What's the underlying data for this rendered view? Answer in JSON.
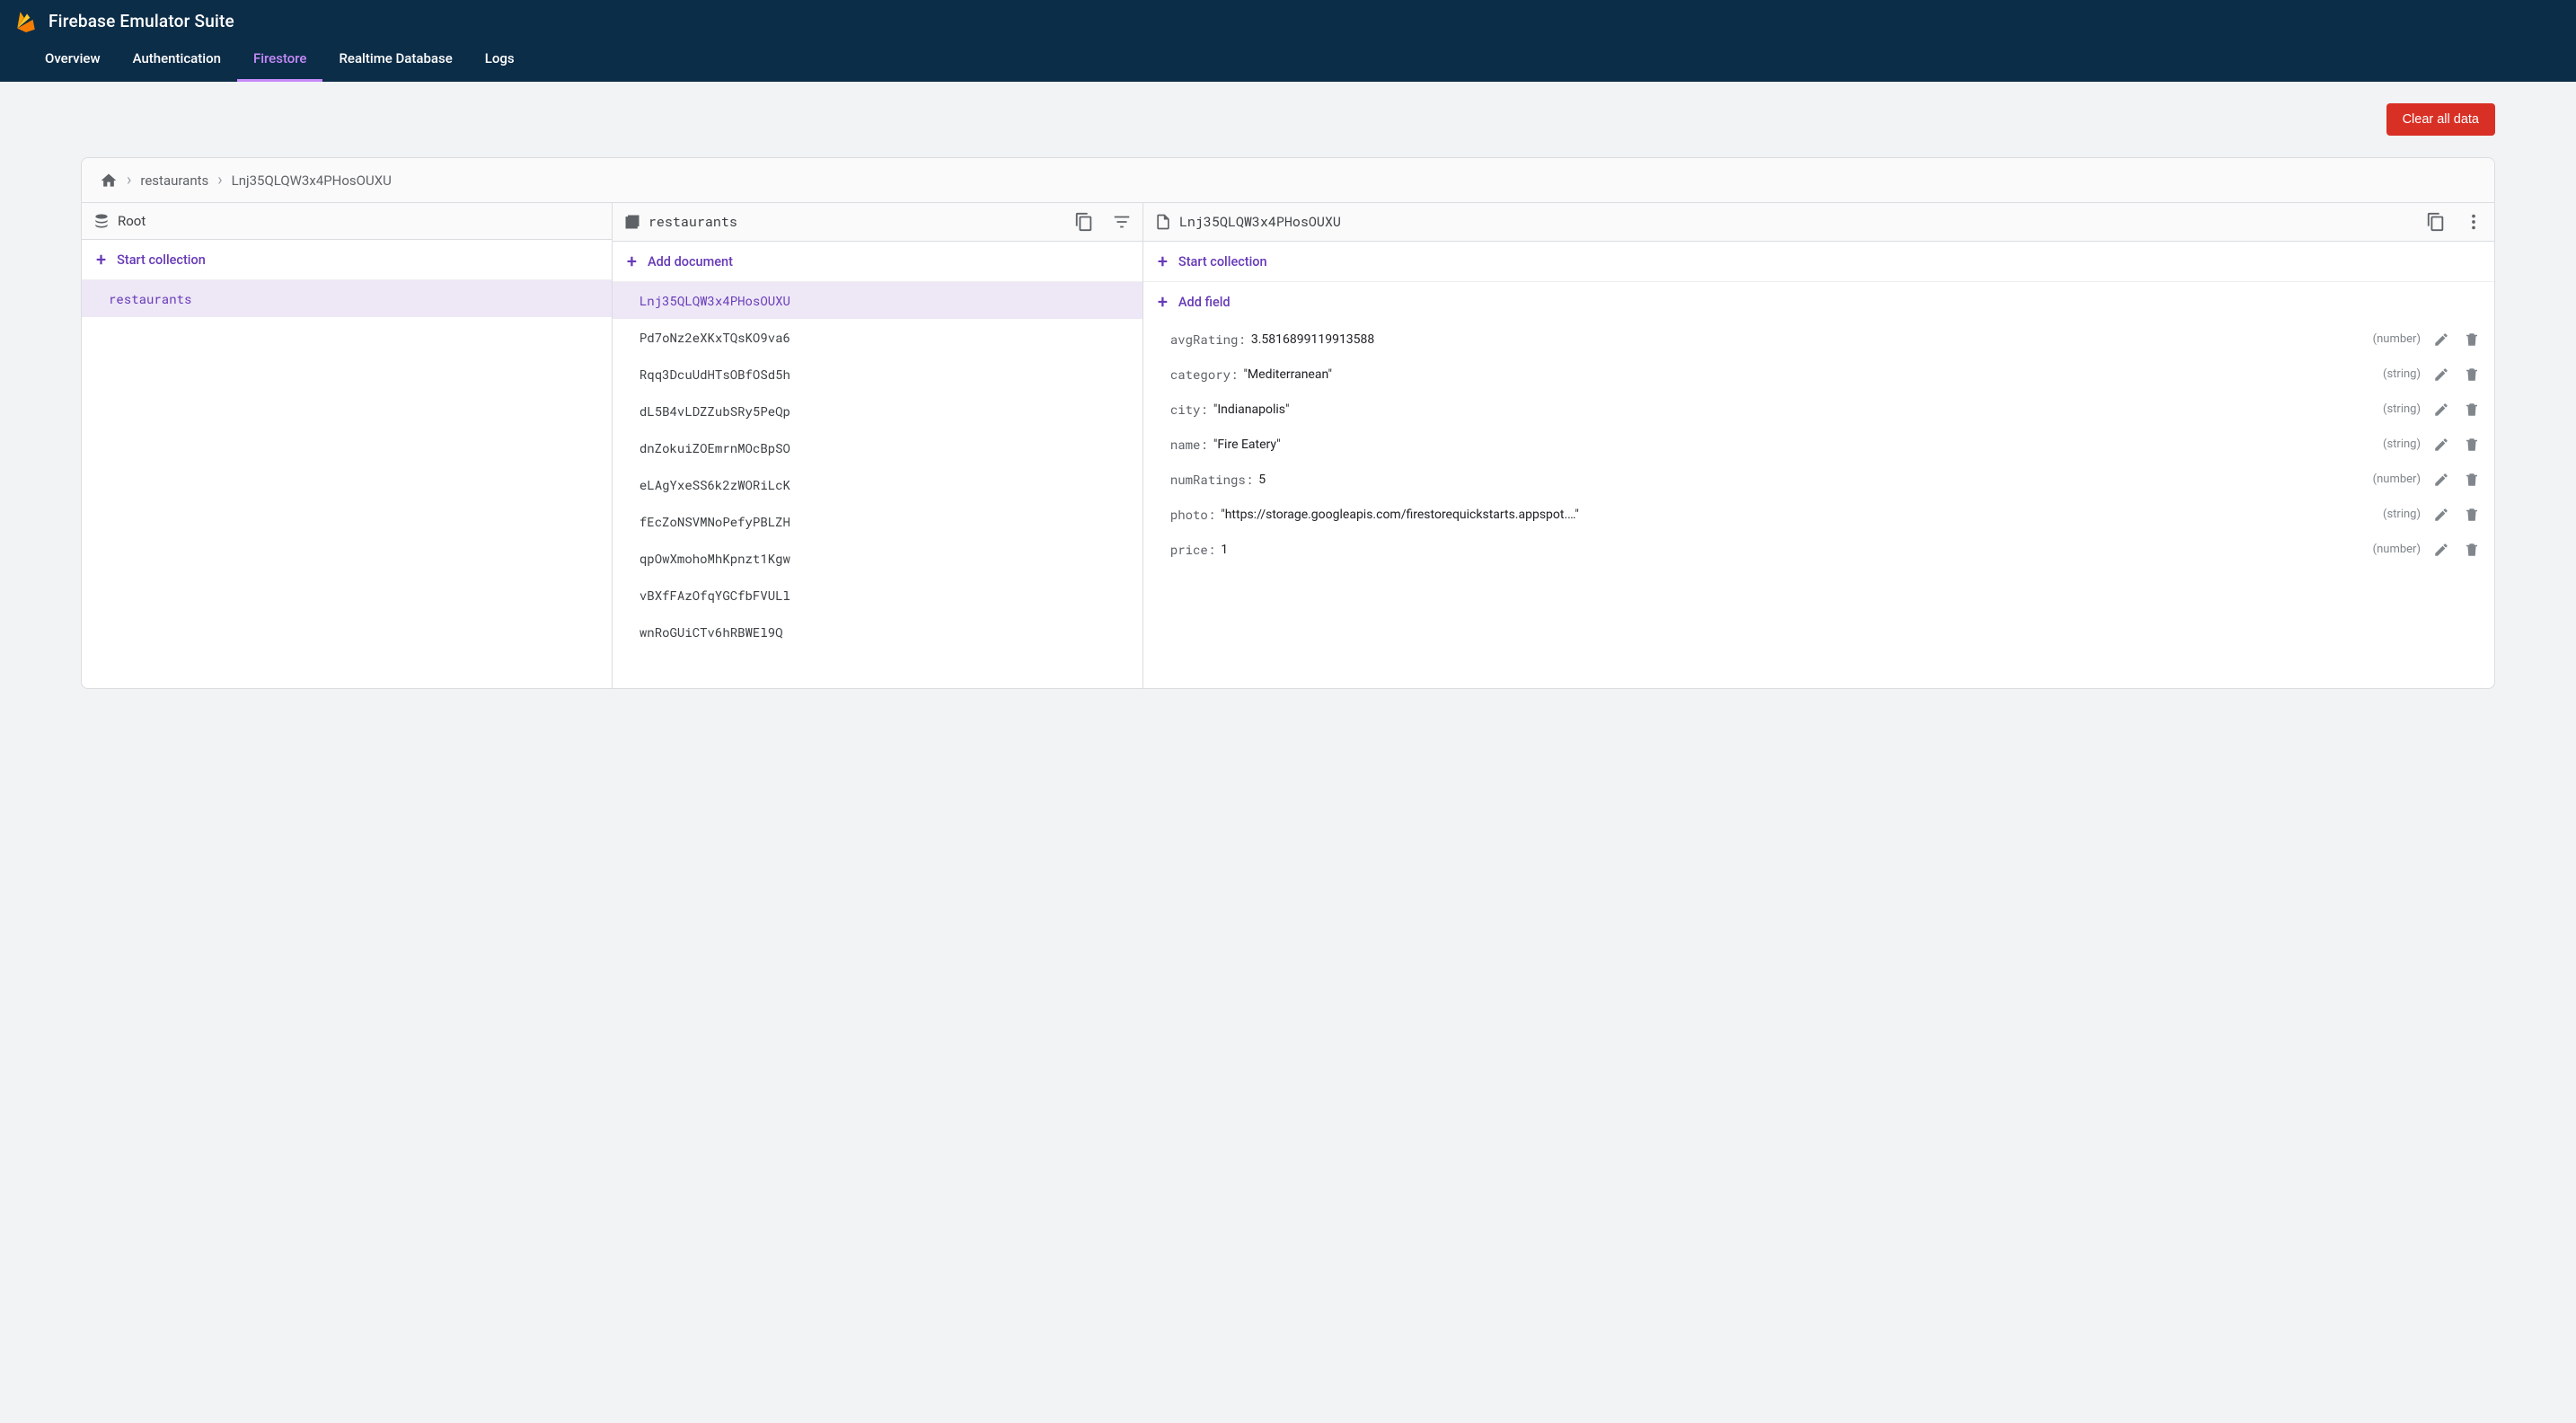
{
  "header": {
    "app_title": "Firebase Emulator Suite",
    "tabs": [
      "Overview",
      "Authentication",
      "Firestore",
      "Realtime Database",
      "Logs"
    ],
    "active_tab": "Firestore"
  },
  "toolbar": {
    "clear_button": "Clear all data"
  },
  "breadcrumbs": [
    "restaurants",
    "Lnj35QLQW3x4PHosOUXU"
  ],
  "col1": {
    "title": "Root",
    "action": "Start collection",
    "items": [
      "restaurants"
    ],
    "selected": "restaurants"
  },
  "col2": {
    "title": "restaurants",
    "action": "Add document",
    "items": [
      "Lnj35QLQW3x4PHosOUXU",
      "Pd7oNz2eXKxTQsKO9va6",
      "Rqq3DcuUdHTsOBfOSd5h",
      "dL5B4vLDZZubSRy5PeQp",
      "dnZokuiZOEmrnMOcBpSO",
      "eLAgYxeSS6k2zWORiLcK",
      "fEcZoNSVMNoPefyPBLZH",
      "qpOwXmohoMhKpnzt1Kgw",
      "vBXfFAzOfqYGCfbFVULl",
      "wnRoGUiCTv6hRBWEl9Q"
    ],
    "selected": "Lnj35QLQW3x4PHosOUXU"
  },
  "col3": {
    "title": "Lnj35QLQW3x4PHosOUXU",
    "action": "Start collection",
    "add_field": "Add field",
    "fields": [
      {
        "key": "avgRating",
        "value": "3.5816899119913588",
        "type": "number",
        "quoted": false
      },
      {
        "key": "category",
        "value": "Mediterranean",
        "type": "string",
        "quoted": true
      },
      {
        "key": "city",
        "value": "Indianapolis",
        "type": "string",
        "quoted": true
      },
      {
        "key": "name",
        "value": "Fire Eatery",
        "type": "string",
        "quoted": true
      },
      {
        "key": "numRatings",
        "value": "5",
        "type": "number",
        "quoted": false
      },
      {
        "key": "photo",
        "value": "https://storage.googleapis.com/firestorequickstarts.appspot.…",
        "type": "string",
        "quoted": true
      },
      {
        "key": "price",
        "value": "1",
        "type": "number",
        "quoted": false
      }
    ]
  }
}
